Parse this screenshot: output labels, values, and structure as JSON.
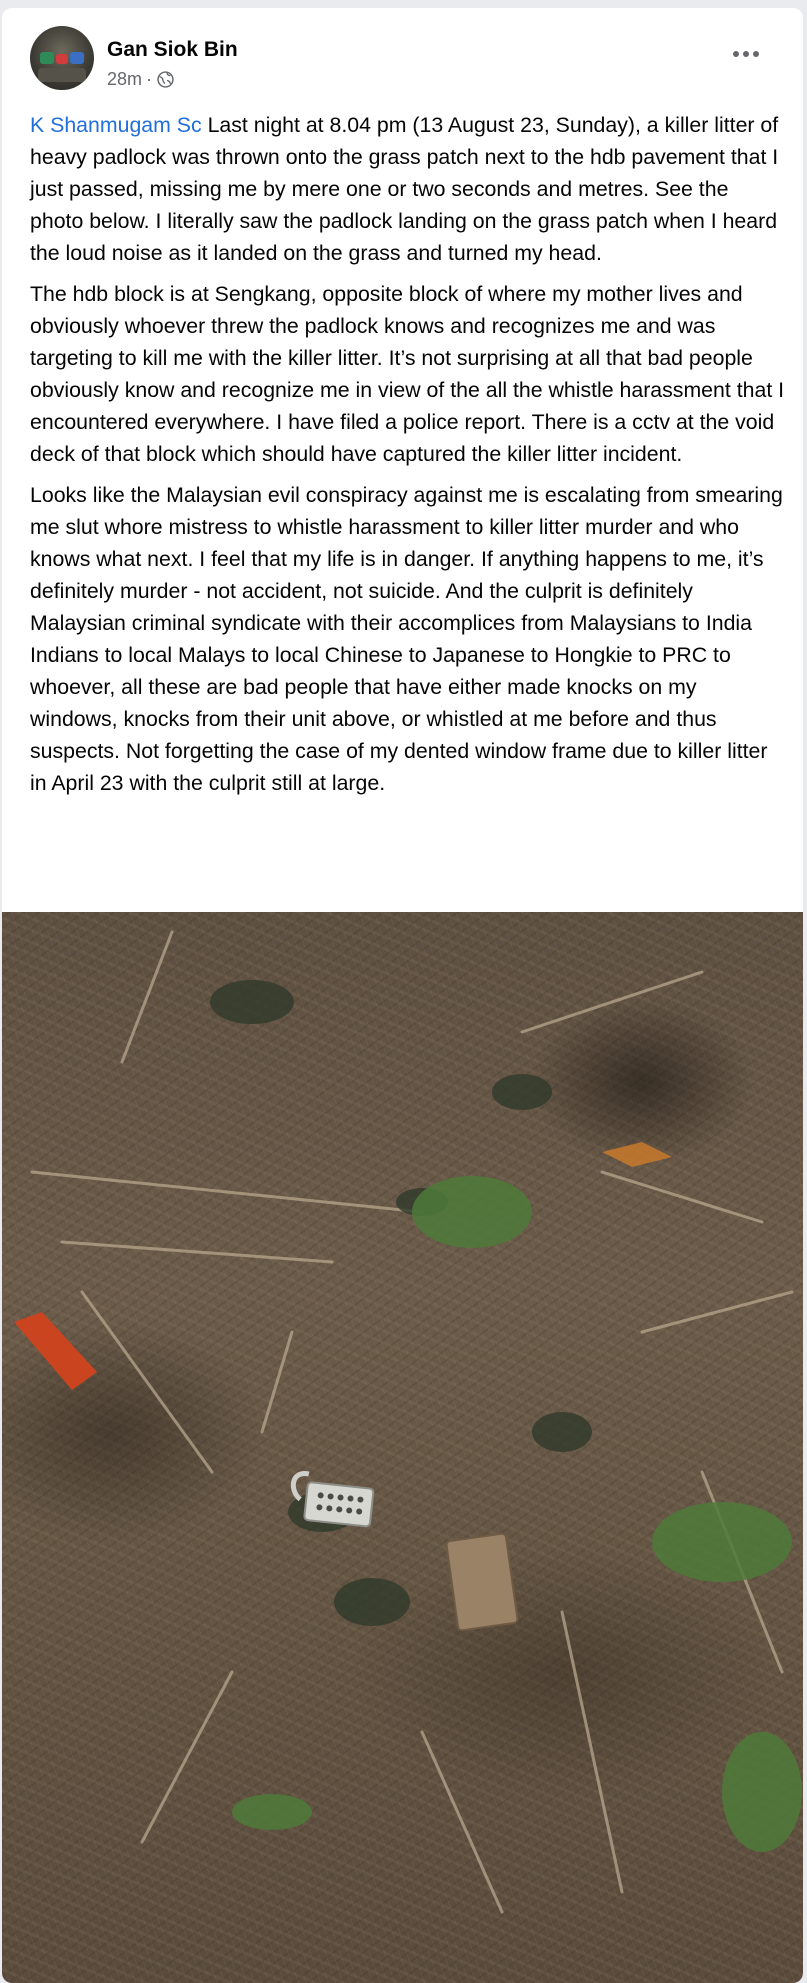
{
  "post": {
    "author": "Gan Siok Bin",
    "time": "28m",
    "separator": "·",
    "privacy_icon": "globe-icon",
    "more_icon": "more-options-icon",
    "mention": "K Shanmugam Sc",
    "paragraph1_rest": " Last night at 8.04 pm (13 August 23, Sunday), a killer litter of heavy padlock was thrown onto the grass patch next to the hdb pavement that I just passed, missing me by mere one or two seconds and metres. See the photo below. I literally saw the padlock landing on the grass patch when I heard the loud noise as it landed on the grass and turned my head.",
    "paragraph2": "The hdb block is at Sengkang, opposite block of where my mother lives and obviously whoever threw the padlock knows and recognizes me and was targeting to kill me with the killer litter. It’s not surprising at all that bad people obviously know and recognize me in view of the all the whistle harassment that I encountered everywhere. I have filed a police report. There is a cctv at the void deck of that block which should have captured the killer litter incident.",
    "paragraph3": "Looks like the Malaysian evil conspiracy against me is escalating from smearing me slut whore mistress to whistle harassment to killer litter murder and who knows what next. I feel that my life is in danger. If anything happens to me, it’s definitely murder - not accident, not suicide.  And the culprit is definitely Malaysian criminal syndicate with their accomplices from Malaysians to India Indians to local Malays to local Chinese to Japanese to Hongkie to PRC to whoever, all these are bad people that have either made knocks on my windows, knocks from their unit above, or whistled at me before and thus suspects. Not forgetting the case of my dented window frame due to killer litter in April 23 with the culprit still at large."
  },
  "colors": {
    "link": "#216fdb",
    "text": "#050505",
    "secondary": "#65676b"
  }
}
